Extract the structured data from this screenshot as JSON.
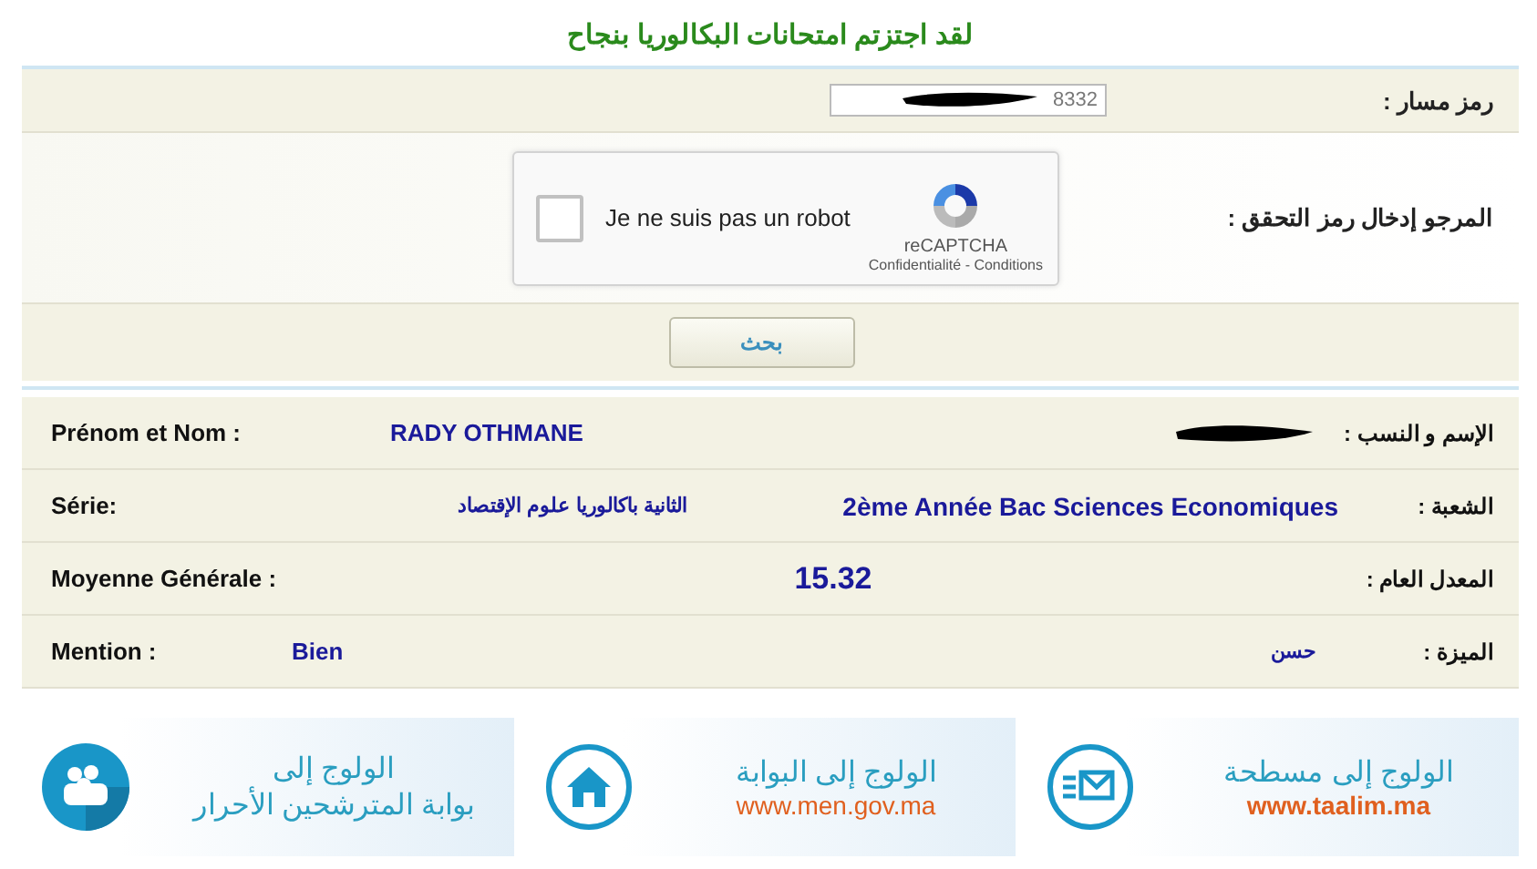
{
  "title": "لقد اجتزتم امتحانات البكالوريا بنجاح",
  "form": {
    "massar_label": "رمز مسار :",
    "massar_value": "8332",
    "captcha_label": "المرجو إدخال رمز التحقق :",
    "captcha": {
      "checked": false,
      "text": "Je ne suis pas un robot",
      "brand": "reCAPTCHA",
      "links": "Confidentialité - Conditions"
    },
    "search_button": "بحث"
  },
  "results": [
    {
      "kind": "name",
      "label_fr": "Prénom et Nom :",
      "value_fr": "RADY OTHMANE",
      "label_ar": "الإسم و النسب :"
    },
    {
      "kind": "serie",
      "label_fr": "Série:",
      "value_ar": "الثانية باكالوريا علوم الإقتصاد",
      "value_fr": "2ème Année Bac Sciences Economiques",
      "label_ar": "الشعبة :"
    },
    {
      "kind": "moyenne",
      "label_fr": "Moyenne Générale :",
      "value": "15.32",
      "label_ar": "المعدل العام :"
    },
    {
      "kind": "mention",
      "label_fr": "Mention :",
      "value_fr": "Bien",
      "value_ar": "حسن",
      "label_ar": "الميزة :"
    }
  ],
  "banners": [
    {
      "kind": "mail",
      "line1": "الولوج إلى مسطحة",
      "line2": "www.taalim.ma"
    },
    {
      "kind": "home",
      "line1": "الولوج إلى البوابة",
      "line2": "www.men.gov.ma"
    },
    {
      "kind": "people",
      "line1": "الولوج إلى",
      "line2": "بوابة المترشحين الأحرار"
    }
  ]
}
